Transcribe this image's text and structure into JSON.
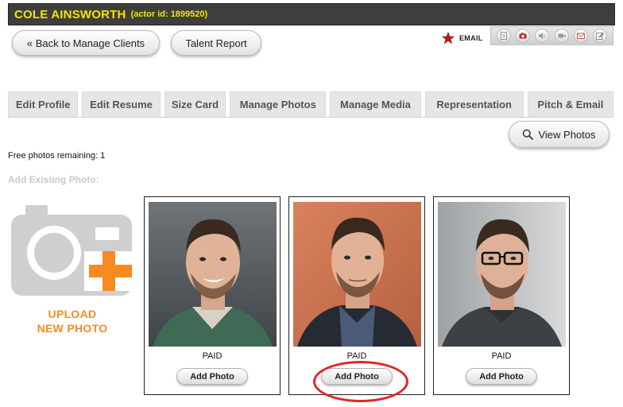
{
  "header": {
    "actor_name": "COLE AINSWORTH",
    "actor_id_label": "(actor id: 1899520)"
  },
  "nav": {
    "back_label": "« Back to Manage Clients",
    "talent_report_label": "Talent Report"
  },
  "toolbar": {
    "email_label": "EMAIL",
    "icons": [
      "notes-icon",
      "camera-icon",
      "audio-icon",
      "video-icon",
      "mail-icon",
      "edit-icon"
    ],
    "colors": {
      "star": "#c0161c"
    }
  },
  "tabs": [
    {
      "label": "Edit Profile"
    },
    {
      "label": "Edit Resume"
    },
    {
      "label": "Size Card"
    },
    {
      "label": "Manage Photos"
    },
    {
      "label": "Manage Media"
    },
    {
      "label": "Representation"
    },
    {
      "label": "Pitch & Email"
    }
  ],
  "view_photos_label": "View Photos",
  "free_photos_text": "Free photos remaining: 1",
  "add_existing_label": "Add Existing Photo:",
  "upload": {
    "line1": "UPLOAD",
    "line2": "NEW PHOTO",
    "accent_color": "#f68b1f"
  },
  "photos": [
    {
      "status": "PAID",
      "button_label": "Add Photo"
    },
    {
      "status": "PAID",
      "button_label": "Add Photo"
    },
    {
      "status": "PAID",
      "button_label": "Add Photo"
    }
  ],
  "highlight_color": "#e0262b"
}
